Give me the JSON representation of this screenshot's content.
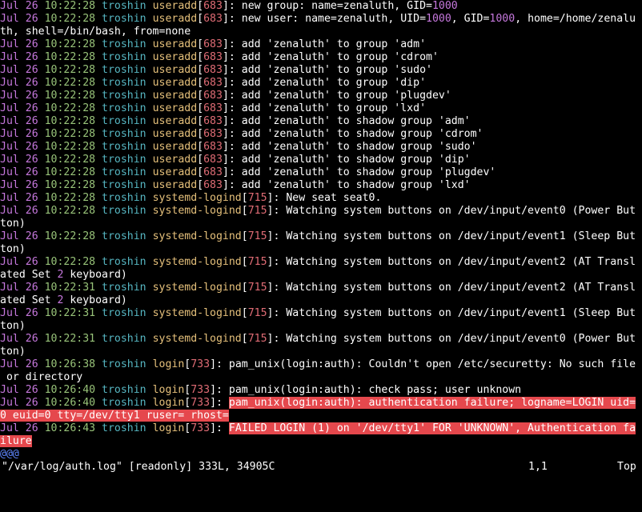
{
  "colors": {
    "date": "#c678dd",
    "time": "#98c379",
    "host": "#56b6c2",
    "proc": "#e5c07b",
    "pid": "#e06c75",
    "number": "#c678dd",
    "text": "#ffffff",
    "highlight_bg": "#e5484d",
    "tilde": "#5f87ff"
  },
  "lines": [
    [
      [
        "Jul 26 ",
        "date"
      ],
      [
        "10:22:28 ",
        "time"
      ],
      [
        "troshin ",
        "host"
      ],
      [
        "useradd",
        "proc"
      ],
      [
        "[",
        "t"
      ],
      [
        "683",
        "pid"
      ],
      [
        "]: new group: name=zenaluth, GID=",
        "t"
      ],
      [
        "1000",
        "number"
      ]
    ],
    [
      [
        "Jul 26 ",
        "date"
      ],
      [
        "10:22:28 ",
        "time"
      ],
      [
        "troshin ",
        "host"
      ],
      [
        "useradd",
        "proc"
      ],
      [
        "[",
        "t"
      ],
      [
        "683",
        "pid"
      ],
      [
        "]: new user: name=zenaluth, UID=",
        "t"
      ],
      [
        "1000",
        "number"
      ],
      [
        ", GID=",
        "t"
      ],
      [
        "1000",
        "number"
      ],
      [
        ", home=/home/zenalu",
        "t"
      ]
    ],
    [
      [
        "th, shell=/bin/bash, from=none",
        "t"
      ]
    ],
    [
      [
        "Jul 26 ",
        "date"
      ],
      [
        "10:22:28 ",
        "time"
      ],
      [
        "troshin ",
        "host"
      ],
      [
        "useradd",
        "proc"
      ],
      [
        "[",
        "t"
      ],
      [
        "683",
        "pid"
      ],
      [
        "]: add 'zenaluth' to group 'adm'",
        "t"
      ]
    ],
    [
      [
        "Jul 26 ",
        "date"
      ],
      [
        "10:22:28 ",
        "time"
      ],
      [
        "troshin ",
        "host"
      ],
      [
        "useradd",
        "proc"
      ],
      [
        "[",
        "t"
      ],
      [
        "683",
        "pid"
      ],
      [
        "]: add 'zenaluth' to group 'cdrom'",
        "t"
      ]
    ],
    [
      [
        "Jul 26 ",
        "date"
      ],
      [
        "10:22:28 ",
        "time"
      ],
      [
        "troshin ",
        "host"
      ],
      [
        "useradd",
        "proc"
      ],
      [
        "[",
        "t"
      ],
      [
        "683",
        "pid"
      ],
      [
        "]: add 'zenaluth' to group 'sudo'",
        "t"
      ]
    ],
    [
      [
        "Jul 26 ",
        "date"
      ],
      [
        "10:22:28 ",
        "time"
      ],
      [
        "troshin ",
        "host"
      ],
      [
        "useradd",
        "proc"
      ],
      [
        "[",
        "t"
      ],
      [
        "683",
        "pid"
      ],
      [
        "]: add 'zenaluth' to group 'dip'",
        "t"
      ]
    ],
    [
      [
        "Jul 26 ",
        "date"
      ],
      [
        "10:22:28 ",
        "time"
      ],
      [
        "troshin ",
        "host"
      ],
      [
        "useradd",
        "proc"
      ],
      [
        "[",
        "t"
      ],
      [
        "683",
        "pid"
      ],
      [
        "]: add 'zenaluth' to group 'plugdev'",
        "t"
      ]
    ],
    [
      [
        "Jul 26 ",
        "date"
      ],
      [
        "10:22:28 ",
        "time"
      ],
      [
        "troshin ",
        "host"
      ],
      [
        "useradd",
        "proc"
      ],
      [
        "[",
        "t"
      ],
      [
        "683",
        "pid"
      ],
      [
        "]: add 'zenaluth' to group 'lxd'",
        "t"
      ]
    ],
    [
      [
        "Jul 26 ",
        "date"
      ],
      [
        "10:22:28 ",
        "time"
      ],
      [
        "troshin ",
        "host"
      ],
      [
        "useradd",
        "proc"
      ],
      [
        "[",
        "t"
      ],
      [
        "683",
        "pid"
      ],
      [
        "]: add 'zenaluth' to shadow group 'adm'",
        "t"
      ]
    ],
    [
      [
        "Jul 26 ",
        "date"
      ],
      [
        "10:22:28 ",
        "time"
      ],
      [
        "troshin ",
        "host"
      ],
      [
        "useradd",
        "proc"
      ],
      [
        "[",
        "t"
      ],
      [
        "683",
        "pid"
      ],
      [
        "]: add 'zenaluth' to shadow group 'cdrom'",
        "t"
      ]
    ],
    [
      [
        "Jul 26 ",
        "date"
      ],
      [
        "10:22:28 ",
        "time"
      ],
      [
        "troshin ",
        "host"
      ],
      [
        "useradd",
        "proc"
      ],
      [
        "[",
        "t"
      ],
      [
        "683",
        "pid"
      ],
      [
        "]: add 'zenaluth' to shadow group 'sudo'",
        "t"
      ]
    ],
    [
      [
        "Jul 26 ",
        "date"
      ],
      [
        "10:22:28 ",
        "time"
      ],
      [
        "troshin ",
        "host"
      ],
      [
        "useradd",
        "proc"
      ],
      [
        "[",
        "t"
      ],
      [
        "683",
        "pid"
      ],
      [
        "]: add 'zenaluth' to shadow group 'dip'",
        "t"
      ]
    ],
    [
      [
        "Jul 26 ",
        "date"
      ],
      [
        "10:22:28 ",
        "time"
      ],
      [
        "troshin ",
        "host"
      ],
      [
        "useradd",
        "proc"
      ],
      [
        "[",
        "t"
      ],
      [
        "683",
        "pid"
      ],
      [
        "]: add 'zenaluth' to shadow group 'plugdev'",
        "t"
      ]
    ],
    [
      [
        "Jul 26 ",
        "date"
      ],
      [
        "10:22:28 ",
        "time"
      ],
      [
        "troshin ",
        "host"
      ],
      [
        "useradd",
        "proc"
      ],
      [
        "[",
        "t"
      ],
      [
        "683",
        "pid"
      ],
      [
        "]: add 'zenaluth' to shadow group 'lxd'",
        "t"
      ]
    ],
    [
      [
        "Jul 26 ",
        "date"
      ],
      [
        "10:22:28 ",
        "time"
      ],
      [
        "troshin ",
        "host"
      ],
      [
        "systemd-logind",
        "proc"
      ],
      [
        "[",
        "t"
      ],
      [
        "715",
        "pid"
      ],
      [
        "]: New seat seat0.",
        "t"
      ]
    ],
    [
      [
        "Jul 26 ",
        "date"
      ],
      [
        "10:22:28 ",
        "time"
      ],
      [
        "troshin ",
        "host"
      ],
      [
        "systemd-logind",
        "proc"
      ],
      [
        "[",
        "t"
      ],
      [
        "715",
        "pid"
      ],
      [
        "]: Watching system buttons on /dev/input/event0 (Power But",
        "t"
      ]
    ],
    [
      [
        "ton)",
        "t"
      ]
    ],
    [
      [
        "Jul 26 ",
        "date"
      ],
      [
        "10:22:28 ",
        "time"
      ],
      [
        "troshin ",
        "host"
      ],
      [
        "systemd-logind",
        "proc"
      ],
      [
        "[",
        "t"
      ],
      [
        "715",
        "pid"
      ],
      [
        "]: Watching system buttons on /dev/input/event1 (Sleep But",
        "t"
      ]
    ],
    [
      [
        "ton)",
        "t"
      ]
    ],
    [
      [
        "Jul 26 ",
        "date"
      ],
      [
        "10:22:28 ",
        "time"
      ],
      [
        "troshin ",
        "host"
      ],
      [
        "systemd-logind",
        "proc"
      ],
      [
        "[",
        "t"
      ],
      [
        "715",
        "pid"
      ],
      [
        "]: Watching system buttons on /dev/input/event2 (AT Transl",
        "t"
      ]
    ],
    [
      [
        "ated Set ",
        "t"
      ],
      [
        "2",
        "number"
      ],
      [
        " keyboard)",
        "t"
      ]
    ],
    [
      [
        "Jul 26 ",
        "date"
      ],
      [
        "10:22:31 ",
        "time"
      ],
      [
        "troshin ",
        "host"
      ],
      [
        "systemd-logind",
        "proc"
      ],
      [
        "[",
        "t"
      ],
      [
        "715",
        "pid"
      ],
      [
        "]: Watching system buttons on /dev/input/event2 (AT Transl",
        "t"
      ]
    ],
    [
      [
        "ated Set ",
        "t"
      ],
      [
        "2",
        "number"
      ],
      [
        " keyboard)",
        "t"
      ]
    ],
    [
      [
        "Jul 26 ",
        "date"
      ],
      [
        "10:22:31 ",
        "time"
      ],
      [
        "troshin ",
        "host"
      ],
      [
        "systemd-logind",
        "proc"
      ],
      [
        "[",
        "t"
      ],
      [
        "715",
        "pid"
      ],
      [
        "]: Watching system buttons on /dev/input/event1 (Sleep But",
        "t"
      ]
    ],
    [
      [
        "ton)",
        "t"
      ]
    ],
    [
      [
        "Jul 26 ",
        "date"
      ],
      [
        "10:22:31 ",
        "time"
      ],
      [
        "troshin ",
        "host"
      ],
      [
        "systemd-logind",
        "proc"
      ],
      [
        "[",
        "t"
      ],
      [
        "715",
        "pid"
      ],
      [
        "]: Watching system buttons on /dev/input/event0 (Power But",
        "t"
      ]
    ],
    [
      [
        "ton)",
        "t"
      ]
    ],
    [
      [
        "Jul 26 ",
        "date"
      ],
      [
        "10:26:38 ",
        "time"
      ],
      [
        "troshin ",
        "host"
      ],
      [
        "login",
        "proc"
      ],
      [
        "[",
        "t"
      ],
      [
        "733",
        "pid"
      ],
      [
        "]: pam_unix(login:auth): Couldn't open /etc/securetty: No such file",
        "t"
      ]
    ],
    [
      [
        " or directory",
        "t"
      ]
    ],
    [
      [
        "Jul 26 ",
        "date"
      ],
      [
        "10:26:40 ",
        "time"
      ],
      [
        "troshin ",
        "host"
      ],
      [
        "login",
        "proc"
      ],
      [
        "[",
        "t"
      ],
      [
        "733",
        "pid"
      ],
      [
        "]: pam_unix(login:auth): check pass; user unknown",
        "t"
      ]
    ],
    [
      [
        "Jul 26 ",
        "date"
      ],
      [
        "10:26:40 ",
        "time"
      ],
      [
        "troshin ",
        "host"
      ],
      [
        "login",
        "proc"
      ],
      [
        "[",
        "t"
      ],
      [
        "733",
        "pid"
      ],
      [
        "]: ",
        "t"
      ],
      [
        "pam_unix(login:auth): authentication failure; logname=LOGIN uid=",
        "hl"
      ]
    ],
    [
      [
        "0 euid=0 tty=/dev/tty1 ruser= rhost=",
        "hl"
      ]
    ],
    [
      [
        "Jul 26 ",
        "date"
      ],
      [
        "10:26:43 ",
        "time"
      ],
      [
        "troshin ",
        "host"
      ],
      [
        "login",
        "proc"
      ],
      [
        "[",
        "t"
      ],
      [
        "733",
        "pid"
      ],
      [
        "]: ",
        "t"
      ],
      [
        "FAILED LOGIN (1) on '/dev/tty1' FOR 'UNKNOWN', Authentication fa",
        "hl"
      ]
    ],
    [
      [
        "ilure",
        "hl"
      ]
    ],
    [
      [
        "@@@",
        "tilde"
      ]
    ]
  ],
  "status": {
    "file": "\"/var/log/auth.log\" [readonly] 333L, 34905C",
    "position": "1,1",
    "scroll": "Top"
  }
}
